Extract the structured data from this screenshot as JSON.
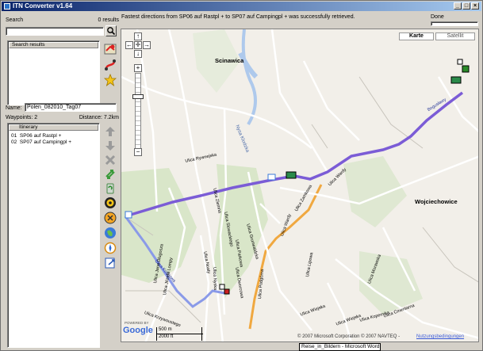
{
  "window": {
    "title": "ITN Converter v1.64"
  },
  "search": {
    "label": "Search",
    "results_count": "0 results",
    "input_value": "",
    "results_header": "Search results"
  },
  "route": {
    "name_label": "Name:",
    "name_value": "Polen_082010_Tag07",
    "waypoints": "Waypoints: 2",
    "distance": "Distance: 7.2km"
  },
  "itinerary": {
    "header": "Itinerary",
    "rows": [
      {
        "num": "01",
        "name": "SP06 auf Rastpl +"
      },
      {
        "num": "02",
        "name": "SP07 auf Campingpl +"
      }
    ]
  },
  "status": {
    "message": "Fastest directions from SP06 auf Rastpl + to SP07 auf Campingpl + was successfully retrieved.",
    "state": "Done"
  },
  "map": {
    "type_buttons": [
      "Karte",
      "Satellit"
    ],
    "places": [
      "Scinawica",
      "Wojciechowice"
    ],
    "streets": [
      "Nysa Klodzka",
      "Ulica Rywnejska",
      "Ulica Wardy",
      "Ulica Zamkowa",
      "Ulica Wardy",
      "Ulica Podgórna",
      "Ulica Slowackiego",
      "Ulica Parkowa",
      "Ulica Grunwaldzka",
      "Ulica Dworcowa",
      "Ulica Nyska",
      "Ulica Noaty",
      "Ulica Kolejowa",
      "Ulica Ziemna",
      "Ulica Jana Długosza",
      "Ulica Józefa Lompy",
      "Ulica Krzywoustego",
      "Ulica Wiejska",
      "Ulica Lipowa",
      "Ulica Morawska",
      "Ulica Wiejska",
      "Ulica Cmentarna",
      "Ulica Kopernika",
      "Bogusławy"
    ],
    "scale_m": "500 m",
    "scale_ft": "2000 ft",
    "powered_by": "POWERED BY",
    "google": "Google",
    "copyright": "© 2007 Microsoft Corporation © 2007 NAVTEQ -",
    "terms_link": "Nutzungsbedingungen",
    "colors": {
      "route": "#7b5cd6",
      "route_secondary": "#8a9ae8",
      "road_orange": "#f5a623",
      "water": "#b5d0f0",
      "green": "#c8dcb0"
    }
  },
  "taskbar_tooltip": "Reise_in_Bildern - Microsoft Word",
  "tools": [
    "up-arrow-icon",
    "down-arrow-icon",
    "delete-icon",
    "swap-icon",
    "recycle-icon",
    "globe-icon",
    "compass-icon",
    "gps-icon",
    "globe-icon",
    "clock-icon",
    "export-icon"
  ],
  "side_icons": [
    "map-pin-icon",
    "route-icon",
    "star-icon"
  ]
}
